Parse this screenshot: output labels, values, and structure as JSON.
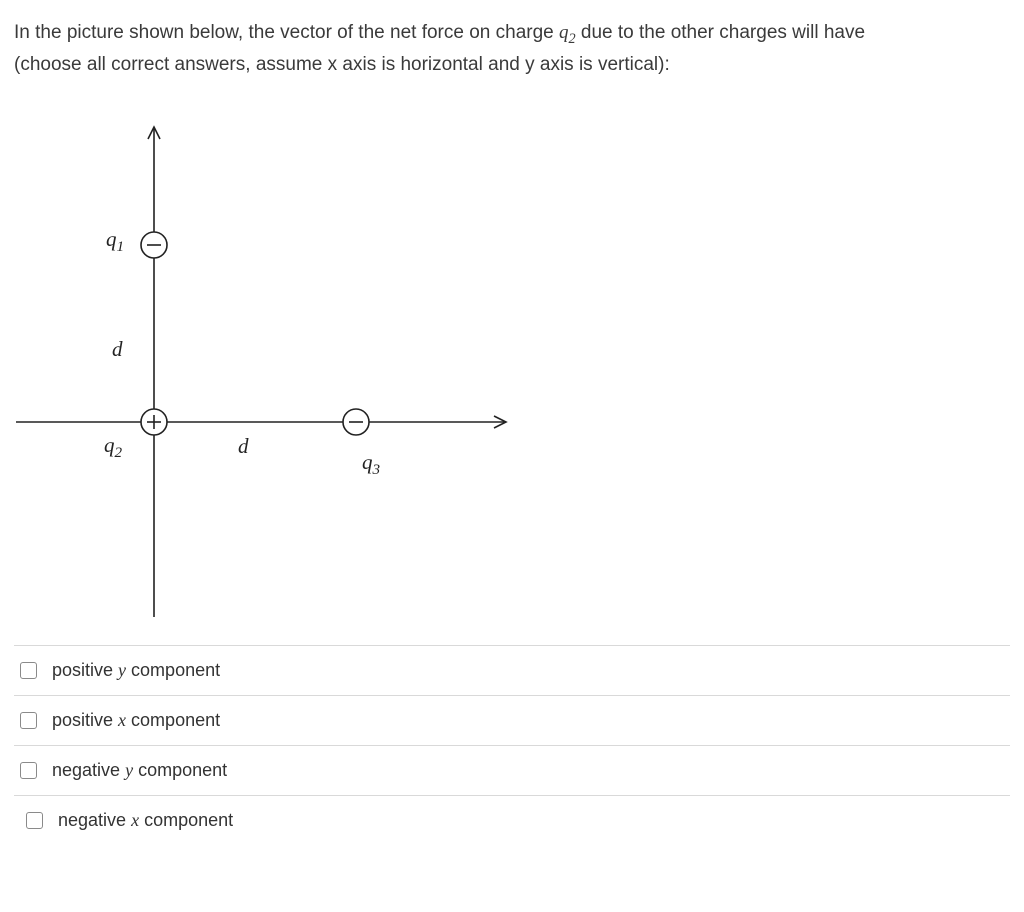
{
  "question": {
    "line1_a": "In the picture shown below, the vector of the net force on charge ",
    "q2_sym": "q",
    "q2_sub": "2",
    "line1_b": "  due to the other charges will have",
    "line2": "(choose all correct answers, assume x axis is horizontal and y axis is vertical):"
  },
  "diagram": {
    "q1": {
      "sym": "q",
      "sub": "1"
    },
    "q2": {
      "sym": "q",
      "sub": "2"
    },
    "q3": {
      "sym": "q",
      "sub": "3"
    },
    "d_upper": "d",
    "d_right": "d"
  },
  "answers": [
    {
      "pre": "positive ",
      "var": "y",
      "post": " component"
    },
    {
      "pre": "positive ",
      "var": "x",
      "post": " component"
    },
    {
      "pre": "negative ",
      "var": "y",
      "post": " component"
    },
    {
      "pre": "negative ",
      "var": "x",
      "post": " component"
    }
  ]
}
